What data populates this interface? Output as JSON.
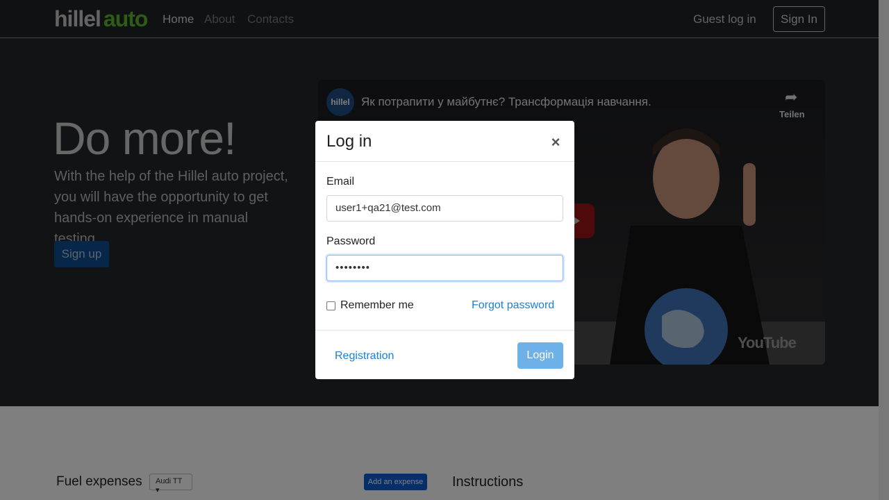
{
  "header": {
    "logo_part1": "hillel",
    "logo_part2": "auto",
    "nav": [
      {
        "label": "Home"
      },
      {
        "label": "About"
      },
      {
        "label": "Contacts"
      }
    ],
    "guest_login": "Guest log in",
    "sign_in": "Sign In"
  },
  "hero": {
    "title": "Do more!",
    "text": "With the help of the Hillel auto project, you will have the opportunity to get hands-on experience in manual testing.",
    "signup": "Sign up"
  },
  "video": {
    "channel": "hillel",
    "title": "Як потрапити у майбутнє? Трансформація навчання.",
    "share_label": "Teilen",
    "platform": "YouTube"
  },
  "content": {
    "fuel_title": "Fuel expenses",
    "car_selected": "Audi TT",
    "add_expense": "Add an expense",
    "instructions_title": "Instructions"
  },
  "modal": {
    "title": "Log in",
    "email_label": "Email",
    "email_value": "user1+qa21@test.com",
    "password_label": "Password",
    "password_value": "••••••••",
    "remember_label": "Remember me",
    "forgot_label": "Forgot password",
    "registration_label": "Registration",
    "login_label": "Login"
  },
  "colors": {
    "brand_green": "#5cb82d",
    "primary_blue": "#0d6efd",
    "link_blue": "#1c7ed6"
  }
}
